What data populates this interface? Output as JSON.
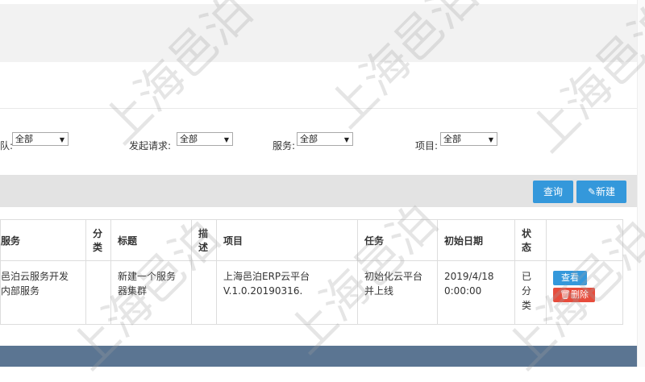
{
  "filters": {
    "team_label": "队:",
    "team_value": "全部",
    "request_label": "发起请求:",
    "request_value": "全部",
    "service_label": "服务:",
    "service_value": "全部",
    "project_label": "项目:",
    "project_value": "全部"
  },
  "toolbar": {
    "query_label": "查询",
    "new_label": "新建"
  },
  "table": {
    "headers": {
      "service": "服务",
      "category_l1": "分",
      "category_l2": "类",
      "title": "标题",
      "desc_l1": "描",
      "desc_l2": "述",
      "project": "项目",
      "task": "任务",
      "start_date": "初始日期",
      "status_l1": "状",
      "status_l2": "态"
    },
    "rows": [
      {
        "service_l1": "邑泊云服务开发",
        "service_l2": "内部服务",
        "category": "",
        "title_l1": "新建一个服务",
        "title_l2": "器集群",
        "desc": "",
        "project_l1": "上海邑泊ERP云平台",
        "project_l2": "V.1.0.20190316.",
        "task_l1": "初始化云平台",
        "task_l2": "并上线",
        "date_l1": "2019/4/18",
        "date_l2": "0:00:00",
        "status_l1": "已",
        "status_l2": "分",
        "status_l3": "类",
        "view_label": "查看",
        "delete_label": "删除"
      }
    ]
  },
  "watermark": "上海邑泊",
  "colors": {
    "primary": "#3498db",
    "danger": "#e74c3c",
    "footer": "#5b7592",
    "toolbar": "#e3e3e3"
  }
}
